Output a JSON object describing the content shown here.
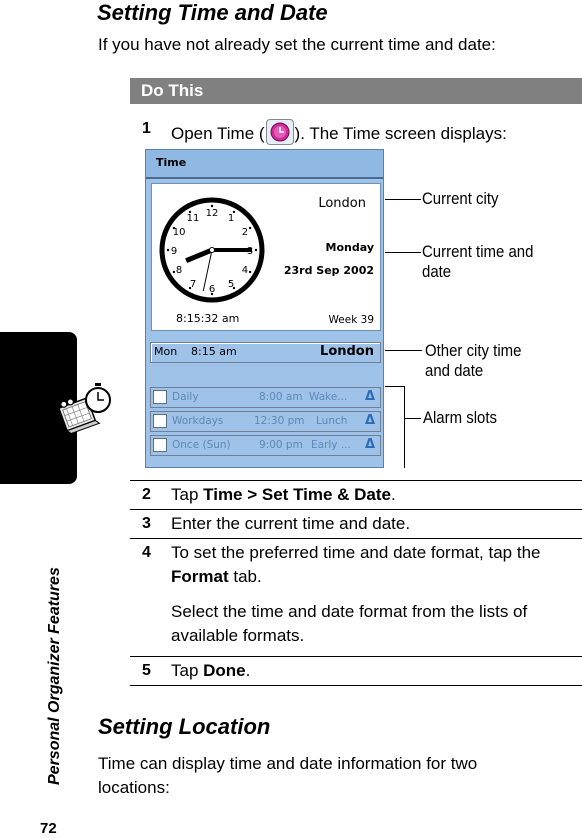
{
  "section1": {
    "heading": "Setting Time and Date",
    "intro": "If you have not already set the current time and date:"
  },
  "table": {
    "header": "Do This",
    "steps": [
      {
        "num": "1",
        "pre": "Open Time (",
        "post": "). The Time screen displays:",
        "icon": "clock-app-icon"
      },
      {
        "num": "2",
        "parts": [
          {
            "t": "Tap ",
            "b": false
          },
          {
            "t": "Time > Set Time & Date",
            "b": true
          },
          {
            "t": ".",
            "b": false
          }
        ]
      },
      {
        "num": "3",
        "text": "Enter the current time and date."
      },
      {
        "num": "4",
        "line1": "To set the preferred time and date format, tap the",
        "bold": "Format",
        "line2rest": " tab.",
        "para": "Select the time and date format from the lists of available formats."
      },
      {
        "num": "5",
        "parts": [
          {
            "t": "Tap ",
            "b": false
          },
          {
            "t": "Done",
            "b": true
          },
          {
            "t": ".",
            "b": false
          }
        ]
      }
    ]
  },
  "screen": {
    "title": "Time",
    "city": "London",
    "day": "Monday",
    "date": "23rd Sep 2002",
    "time": "8:15:32 am",
    "week": "Week 39",
    "clock_numbers": [
      "12",
      "1",
      "2",
      "3",
      "4",
      "5",
      "6",
      "7",
      "8",
      "9",
      "10",
      "11"
    ],
    "clock_hands": {
      "hour": 8.25,
      "minute": 15,
      "second": 32
    },
    "other_city": {
      "day": "Mon",
      "time": "8:15 am",
      "city": "London"
    },
    "alarms": [
      {
        "repeat": "Daily",
        "time": "8:00 am",
        "label": "Wake...",
        "enabled": false
      },
      {
        "repeat": "Workdays",
        "time": "12:30 pm",
        "label": "Lunch",
        "enabled": false
      },
      {
        "repeat": "Once (Sun)",
        "time": "9:00 pm",
        "label": "Early ...",
        "enabled": false
      }
    ],
    "colors": {
      "background": "#9fc3e8",
      "alarm_text": "#5f86b4",
      "alarm_icon": "#2a6cb8"
    }
  },
  "callouts": {
    "current_city": "Current city",
    "current_time_1": "Current time and",
    "current_time_2": "date",
    "other_city_1": "Other city time",
    "other_city_2": "and date",
    "alarm_slots": "Alarm slots"
  },
  "section2": {
    "heading": "Setting Location",
    "text_1": "Time can display time and date information for two",
    "text_2": "locations:"
  },
  "sidebar": {
    "chapter": "Personal Organizer Features",
    "page_number": "72",
    "icon": "organizer-icon"
  }
}
